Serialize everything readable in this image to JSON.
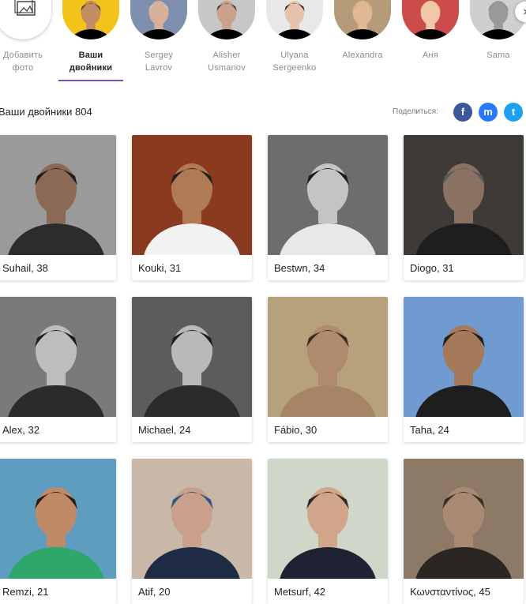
{
  "carousel": {
    "add_label": [
      "Добавить",
      "фото"
    ],
    "items": [
      {
        "label": [
          "Ваши",
          "двойники"
        ],
        "active": true,
        "bg": "#f2c319",
        "skin": "#c28d63",
        "hair": "#5a3a22"
      },
      {
        "label": [
          "Sergey",
          "Lavrov"
        ],
        "active": false,
        "bg": "#7f8fb0",
        "skin": "#d7b09a",
        "hair": "#c9c9c9"
      },
      {
        "label": [
          "Alisher",
          "Usmanov"
        ],
        "active": false,
        "bg": "#c7c7c7",
        "skin": "#caa18a",
        "hair": "#333333"
      },
      {
        "label": [
          "Ulyana",
          "Sergeenko"
        ],
        "active": false,
        "bg": "#e8e8e8",
        "skin": "#e4c2ae",
        "hair": "#2a1f1a"
      },
      {
        "label": [
          "Alexandra"
        ],
        "active": false,
        "bg": "#b59b7a",
        "skin": "#e0b894",
        "hair": "#d8b46a"
      },
      {
        "label": [
          "Аня"
        ],
        "active": false,
        "bg": "#cc4b4b",
        "skin": "#f0c8a8",
        "hair": "#e6c56e"
      },
      {
        "label": [
          "Sama"
        ],
        "active": false,
        "bg": "#cfcfcf",
        "skin": "#9a9a9a",
        "hair": "#8a8a8a"
      }
    ],
    "next_icon": "›"
  },
  "results": {
    "title": "Ваши двойники 804",
    "share_label": "Поделиться:",
    "share_buttons": [
      {
        "name": "facebook-share-button",
        "glyph": "f",
        "color": "#3b5998"
      },
      {
        "name": "messenger-share-button",
        "glyph": "m",
        "color": "#2979ff"
      },
      {
        "name": "twitter-share-button",
        "glyph": "t",
        "color": "#1da1f2"
      }
    ]
  },
  "cards": [
    {
      "caption": "Suhail, 38",
      "bg": "#9a9a9a",
      "skin": "#8a6a55",
      "shirt": "#2c2c2c",
      "hair": "#1c1c1c"
    },
    {
      "caption": "Kouki, 31",
      "bg": "#8a3a1e",
      "skin": "#b07a55",
      "shirt": "#f2f2f2",
      "hair": "#222222"
    },
    {
      "caption": "Bestwn, 34",
      "bg": "#6d6d6d",
      "skin": "#c4c4c4",
      "shirt": "#e8e8e8",
      "hair": "#1a1a1a"
    },
    {
      "caption": "Diogo, 31",
      "bg": "#3e3a36",
      "skin": "#8a7262",
      "shirt": "#1e1e1e",
      "hair": "#5a5a5a"
    },
    {
      "caption": "Alex, 32",
      "bg": "#7a7a7a",
      "skin": "#bdbdbd",
      "shirt": "#2b2b2b",
      "hair": "#1e1e1e"
    },
    {
      "caption": "Michael, 24",
      "bg": "#5c5c5c",
      "skin": "#b9b9b9",
      "shirt": "#2b2b2b",
      "hair": "#1e1e1e"
    },
    {
      "caption": "Fábio, 30",
      "bg": "#b5a27c",
      "skin": "#b08a6c",
      "shirt": "#a58566",
      "hair": "#3a2a1e"
    },
    {
      "caption": "Taha, 24",
      "bg": "#6f9bd0",
      "skin": "#a57a5a",
      "shirt": "#1e1e1e",
      "hair": "#1e1e1e"
    },
    {
      "caption": "Remzi, 21",
      "bg": "#5e9cc0",
      "skin": "#c08a66",
      "shirt": "#2da86a",
      "hair": "#2a1e16"
    },
    {
      "caption": "Atif, 20",
      "bg": "#c9b7a8",
      "skin": "#caa08a",
      "shirt": "#1f2a44",
      "hair": "#2d5a8a"
    },
    {
      "caption": "Metsurf, 42",
      "bg": "#cfd8c8",
      "skin": "#d1a58a",
      "shirt": "#1e2232",
      "hair": "#2a2a2a"
    },
    {
      "caption": "Κωνσταντίνος, 45",
      "bg": "#8c7a66",
      "skin": "#a88a72",
      "shirt": "#2a2622",
      "hair": "#3a2e24"
    }
  ]
}
